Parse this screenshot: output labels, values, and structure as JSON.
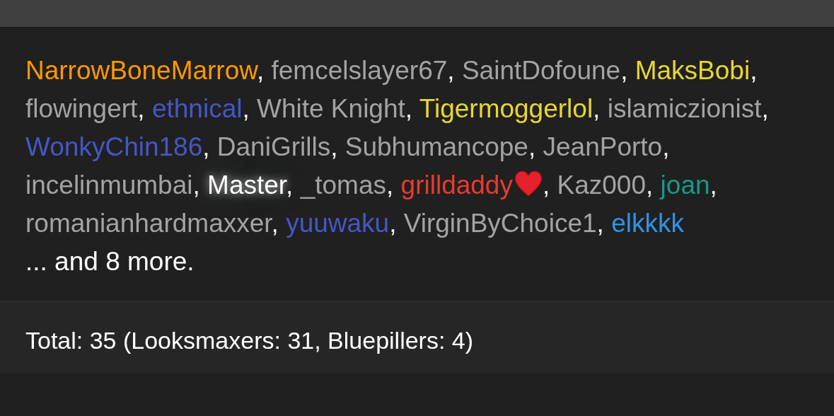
{
  "online_users": {
    "separator": ",",
    "users": [
      {
        "name": "NarrowBoneMarrow",
        "color": "#ff9800",
        "highlighted": false,
        "heart": false
      },
      {
        "name": "femcelslayer67",
        "color": "#a3a3a3",
        "highlighted": false,
        "heart": false
      },
      {
        "name": "SaintDofoune",
        "color": "#a3a3a3",
        "highlighted": false,
        "heart": false
      },
      {
        "name": "MaksBobi",
        "color": "#e8d630",
        "highlighted": false,
        "heart": false
      },
      {
        "name": "flowingert",
        "color": "#a3a3a3",
        "highlighted": false,
        "heart": false
      },
      {
        "name": "ethnical",
        "color": "#4557c4",
        "highlighted": false,
        "heart": false
      },
      {
        "name": "White Knight",
        "color": "#a3a3a3",
        "highlighted": false,
        "heart": false
      },
      {
        "name": "Tigermoggerlol",
        "color": "#e8d630",
        "highlighted": false,
        "heart": false
      },
      {
        "name": "islamiczionist",
        "color": "#a3a3a3",
        "highlighted": false,
        "heart": false
      },
      {
        "name": "WonkyChin186",
        "color": "#4557c4",
        "highlighted": false,
        "heart": false
      },
      {
        "name": "DaniGrills",
        "color": "#a3a3a3",
        "highlighted": false,
        "heart": false
      },
      {
        "name": "Subhumancope",
        "color": "#a3a3a3",
        "highlighted": false,
        "heart": false
      },
      {
        "name": "JeanPorto",
        "color": "#a3a3a3",
        "highlighted": false,
        "heart": false
      },
      {
        "name": "incelinmumbai",
        "color": "#a3a3a3",
        "highlighted": false,
        "heart": false
      },
      {
        "name": "Master",
        "color": "#ffffff",
        "highlighted": true,
        "heart": false
      },
      {
        "name": "_tomas",
        "color": "#a3a3a3",
        "highlighted": false,
        "heart": false
      },
      {
        "name": "grilldaddy",
        "color": "#ea3a2e",
        "highlighted": false,
        "heart": true
      },
      {
        "name": "Kaz000",
        "color": "#a3a3a3",
        "highlighted": false,
        "heart": false
      },
      {
        "name": "joan",
        "color": "#149a88",
        "highlighted": false,
        "heart": false
      },
      {
        "name": "romanianhardmaxxer",
        "color": "#a3a3a3",
        "highlighted": false,
        "heart": false
      },
      {
        "name": "yuuwaku",
        "color": "#4557c4",
        "highlighted": false,
        "heart": false
      },
      {
        "name": "VirginByChoice1",
        "color": "#a3a3a3",
        "highlighted": false,
        "heart": false
      },
      {
        "name": "elkkkk",
        "color": "#2f93e8",
        "highlighted": false,
        "heart": false
      }
    ],
    "more": "... and 8 more."
  },
  "footer": {
    "total": "Total: 35 (Looksmaxers: 31, Bluepillers: 4)"
  }
}
